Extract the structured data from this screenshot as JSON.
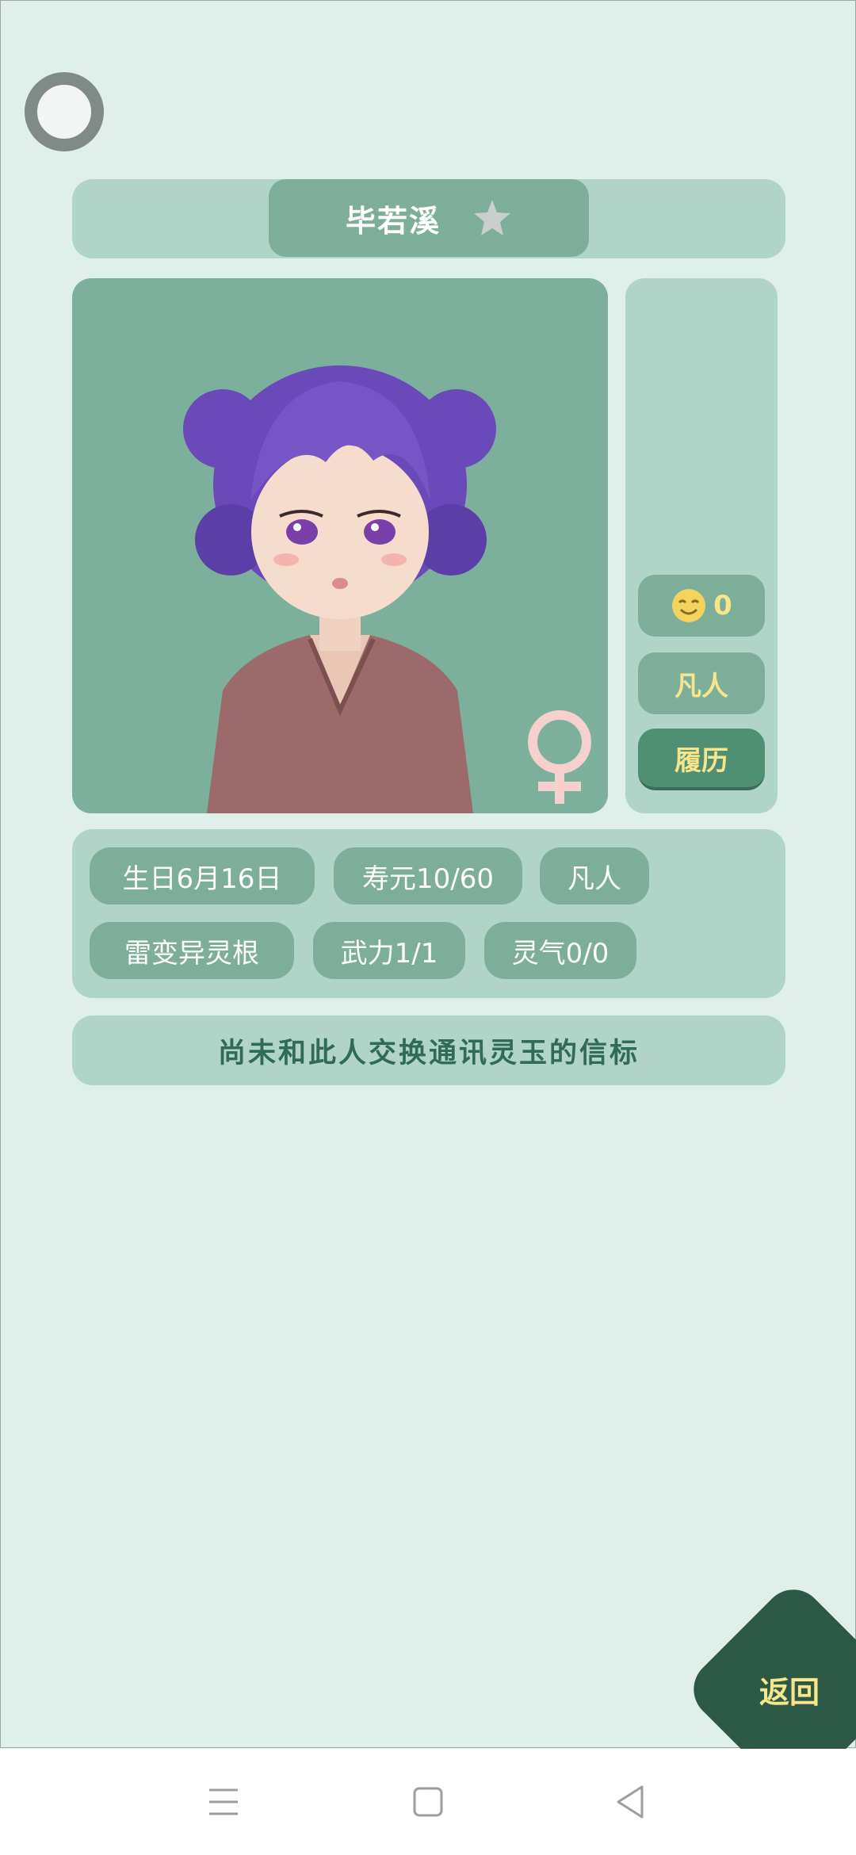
{
  "header": {
    "name": "毕若溪"
  },
  "profile": {
    "mood_value": "0",
    "rank_label": "凡人",
    "history_label": "履历"
  },
  "tags": {
    "birthday": "生日6月16日",
    "lifespan": "寿元10/60",
    "realm": "凡人",
    "spirit_root": "雷变异灵根",
    "force": "武力1/1",
    "qi": "灵气0/0"
  },
  "notice": "尚未和此人交换通讯灵玉的信标",
  "back_label": "返回",
  "colors": {
    "background": "#dfefe9",
    "panel": "#b0d4c8",
    "pill": "#7cae9a",
    "accent_text": "#f6e58a",
    "dark": "#2c5846",
    "gender": "#f4c3c3"
  },
  "icons": {
    "star": "star-icon",
    "gender": "female-symbol-icon",
    "mood": "smiling-face-icon"
  }
}
